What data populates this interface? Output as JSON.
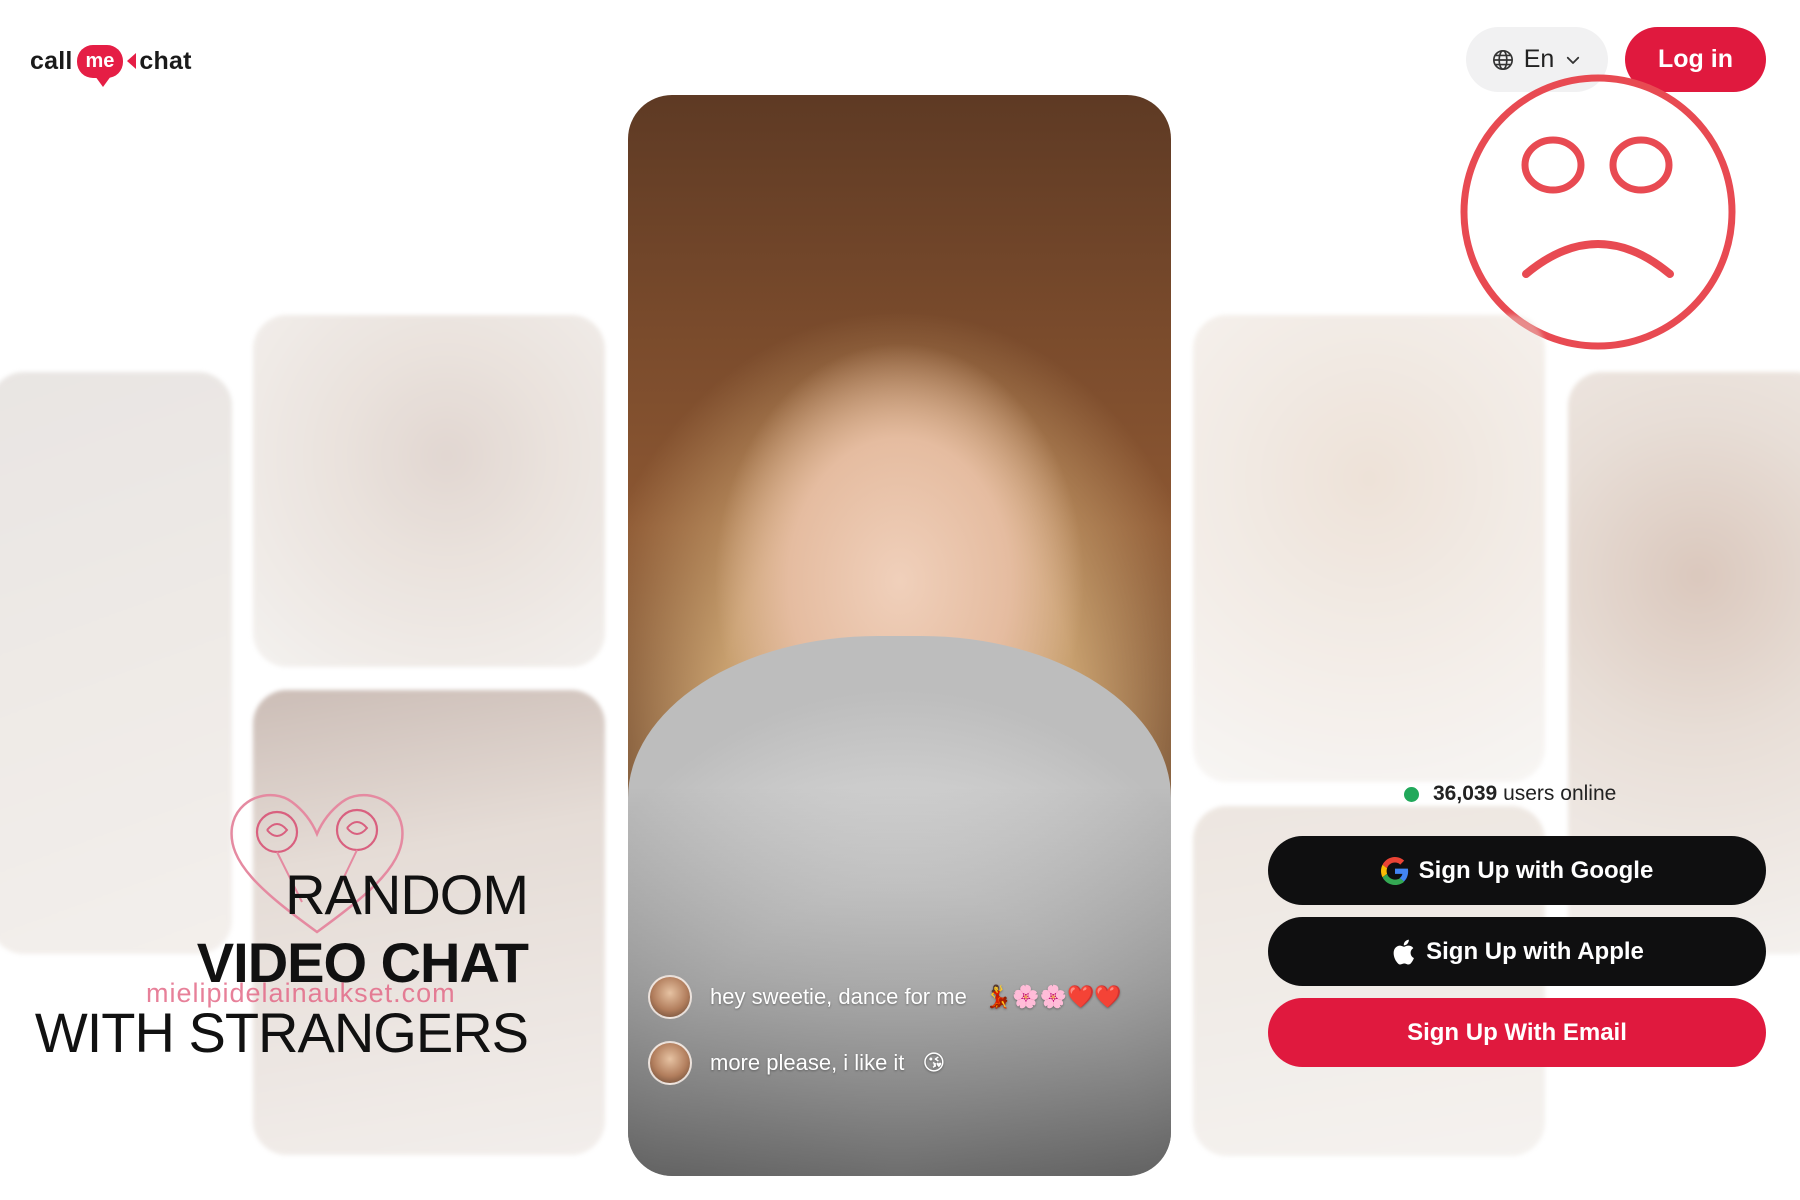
{
  "header": {
    "logo": {
      "part1": "call",
      "part2": "me",
      "part3": "chat"
    },
    "language": {
      "label": "En"
    },
    "login_label": "Log in"
  },
  "hero": {
    "line1": "RANDOM",
    "line2": "VIDEO CHAT",
    "line3": "WITH STRANGERS",
    "watermark": "mielipidelainaukset.com"
  },
  "video": {
    "messages": [
      {
        "text": "hey sweetie, dance for me",
        "emoji": "💃🌸🌸❤️❤️"
      },
      {
        "text": "more please, i like it",
        "emoji": "😘"
      }
    ]
  },
  "signup": {
    "online_count": "36,039",
    "online_label": "users online",
    "google_label": "Sign Up with Google",
    "apple_label": "Sign Up with Apple",
    "email_label": "Sign Up With Email"
  },
  "colors": {
    "accent": "#e0193e",
    "dark_button": "#0f0f10",
    "online": "#21a85a",
    "sad_face": "#e84a52"
  },
  "icons": [
    "globe-icon",
    "chevron-down-icon",
    "google-icon",
    "apple-icon",
    "sad-face-icon",
    "roses-heart-icon"
  ]
}
